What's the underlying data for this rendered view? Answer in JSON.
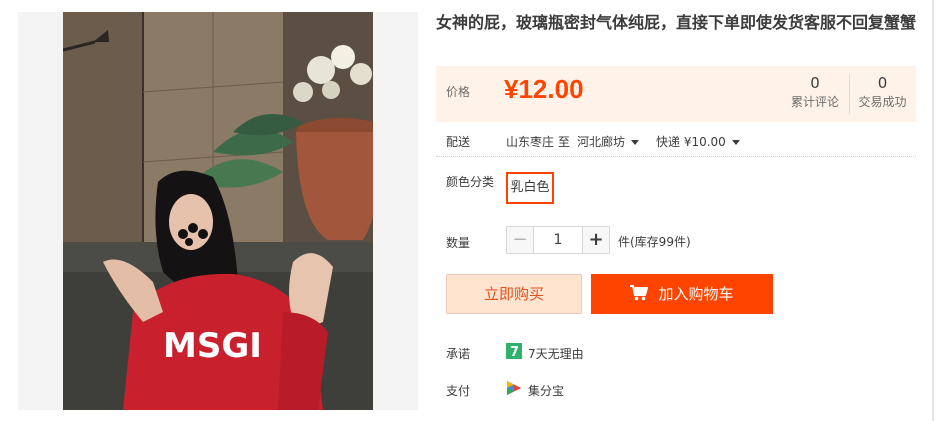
{
  "product": {
    "title": "女神的屁，玻璃瓶密封气体纯屁，直接下单即使发货客服不回复蟹蟹"
  },
  "price": {
    "label": "价格",
    "value": "¥12.00",
    "color": "#ff4400"
  },
  "stats": {
    "reviews_count": "0",
    "reviews_label": "累计评论",
    "sold_count": "0",
    "sold_label": "交易成功"
  },
  "shipping": {
    "label": "配送",
    "from": "山东枣庄 至",
    "to": "河北廊坊",
    "fee": "快递 ¥10.00"
  },
  "color_option": {
    "label": "颜色分类",
    "selected": "乳白色"
  },
  "quantity": {
    "label": "数量",
    "value": "1",
    "minus": "−",
    "plus": "+",
    "stock": "件(库存99件)"
  },
  "actions": {
    "buy_now": "立即购买",
    "add_to_cart": "加入购物车"
  },
  "promise": {
    "label": "承诺",
    "icon_text": "7",
    "text": "7天无理由"
  },
  "payment": {
    "label": "支付",
    "text": "集分宝"
  },
  "photo": {
    "sweatshirt_text": "MSGI"
  },
  "icons": {
    "caret": "chevron-down-icon",
    "cart": "cart-icon",
    "promise": "seven-day-icon",
    "payment": "jifenbao-icon"
  }
}
